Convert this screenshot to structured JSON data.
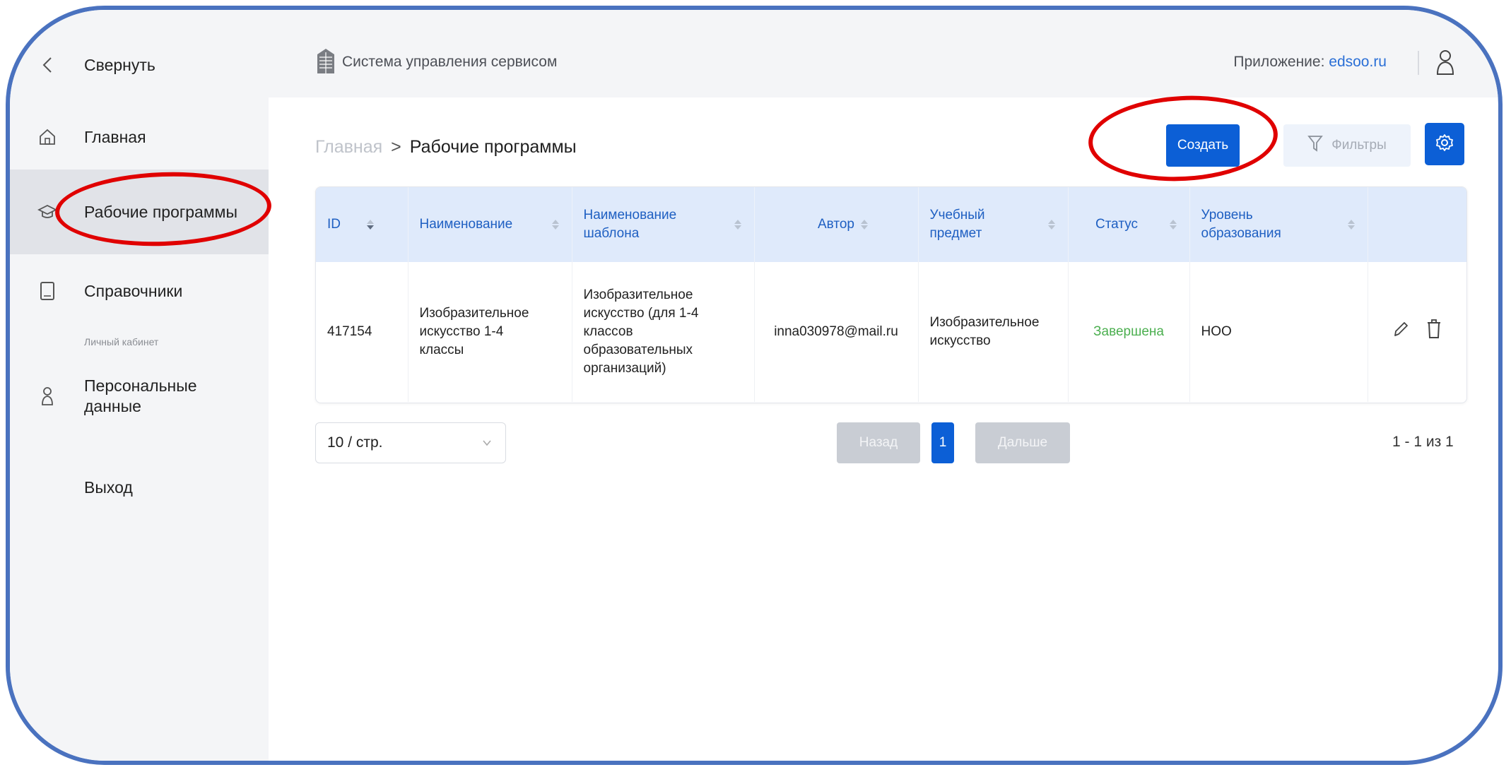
{
  "sidebar": {
    "collapse_label": "Свернуть",
    "items": [
      {
        "label": "Главная",
        "icon": "home-icon"
      },
      {
        "label": "Рабочие программы",
        "icon": "graduation-cap-icon",
        "active": true
      },
      {
        "label": "Справочники",
        "icon": "book-icon"
      }
    ],
    "section_label": "Личный кабинет",
    "personal": {
      "label": "Персональные данные",
      "icon": "user-icon"
    },
    "logout_label": "Выход"
  },
  "header": {
    "title": "Система управления сервисом",
    "app_label": "Приложение:",
    "app_link": "edsoo.ru"
  },
  "breadcrumb": {
    "home": "Главная",
    "separator": ">",
    "current": "Рабочие программы"
  },
  "toolbar": {
    "create_label": "Создать",
    "filter_label": "Фильтры"
  },
  "table": {
    "columns": [
      "ID",
      "Наименование",
      "Наименование шаблона",
      "Автор",
      "Учебный предмет",
      "Статус",
      "Уровень образования"
    ],
    "rows": [
      {
        "id": "417154",
        "name": "Изобразительное искусство 1-4 классы",
        "template": "Изобразительное искусство (для 1-4 классов образовательных организаций)",
        "author": "inna030978@mail.ru",
        "subject": "Изобразительное искусство",
        "status": "Завершена",
        "level": "НОО"
      }
    ]
  },
  "pagination": {
    "page_size": "10 / стр.",
    "prev_label": "Назад",
    "current_page": "1",
    "next_label": "Дальше",
    "range": "1 - 1 из 1"
  },
  "colors": {
    "primary": "#0c5fd6",
    "status_done": "#4caf50",
    "annotation": "#e00000",
    "frame": "#4a72bf"
  }
}
